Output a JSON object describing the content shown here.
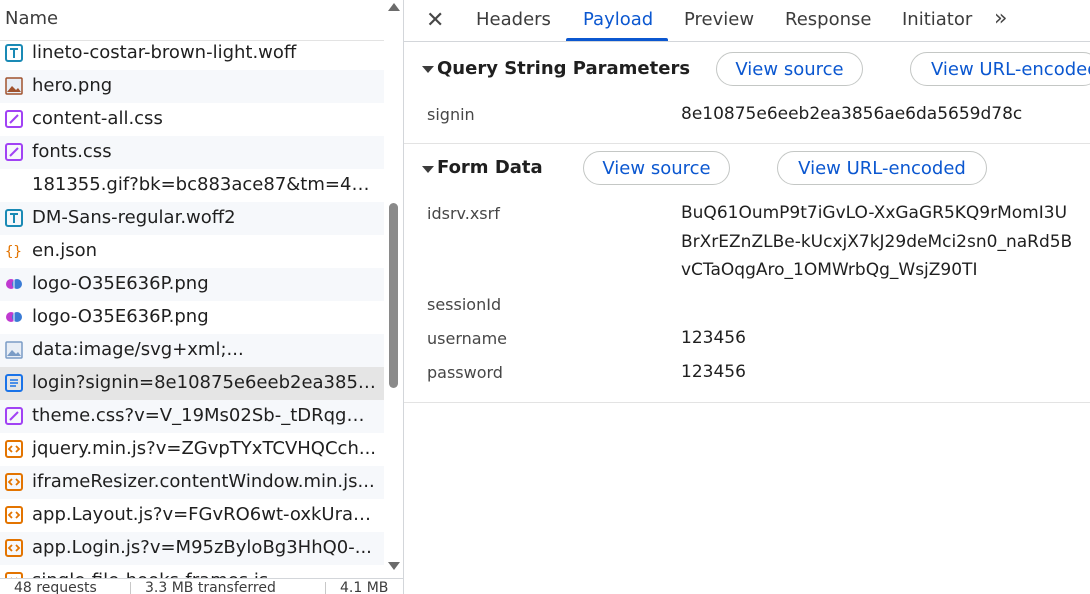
{
  "list": {
    "header": "Name",
    "rows": [
      {
        "name": "lineto-costar-brown-light.woff",
        "icon": "font-icon",
        "color": "#1a8ab5"
      },
      {
        "name": "hero.png",
        "icon": "image-icon",
        "color": "#a0522d"
      },
      {
        "name": "content-all.css",
        "icon": "stylesheet-icon",
        "color": "#a142f4"
      },
      {
        "name": "fonts.css",
        "icon": "stylesheet-icon",
        "color": "#a142f4"
      },
      {
        "name": "181355.gif?bk=bc883ace87&tm=44...",
        "icon": "blank-icon",
        "color": "#ffffff"
      },
      {
        "name": "DM-Sans-regular.woff2",
        "icon": "font-icon",
        "color": "#1a8ab5"
      },
      {
        "name": "en.json",
        "icon": "json-icon",
        "color": "#e37400"
      },
      {
        "name": "logo-O35E636P.png",
        "icon": "brain-logo-icon",
        "color": "#c03ad0"
      },
      {
        "name": "logo-O35E636P.png",
        "icon": "brain-logo-icon",
        "color": "#c03ad0"
      },
      {
        "name": "data:image/svg+xml;...",
        "icon": "image-icon",
        "color": "#7a9cc6"
      },
      {
        "name": "login?signin=8e10875e6eeb2ea3856...",
        "icon": "document-icon",
        "color": "#1a73e8"
      },
      {
        "name": "theme.css?v=V_19Ms02Sb-_tDRqgN...",
        "icon": "stylesheet-icon",
        "color": "#a142f4"
      },
      {
        "name": "jquery.min.js?v=ZGvpTYxTCVHQCch...",
        "icon": "script-icon",
        "color": "#e37400"
      },
      {
        "name": "iframeResizer.contentWindow.min.js...",
        "icon": "script-icon",
        "color": "#e37400"
      },
      {
        "name": "app.Layout.js?v=FGvRO6wt-oxkUrab...",
        "icon": "script-icon",
        "color": "#e37400"
      },
      {
        "name": "app.Login.js?v=M95zByloBg3HhQ0-...",
        "icon": "script-icon",
        "color": "#e37400"
      },
      {
        "name": "single-file-hooks-frames.js",
        "icon": "script-icon",
        "color": "#e37400"
      }
    ],
    "selected_index": 10
  },
  "status": {
    "requests": "48 requests",
    "transferred": "3.3 MB transferred",
    "resources": "4.1 MB"
  },
  "tabs": {
    "close": "✕",
    "items": [
      "Headers",
      "Payload",
      "Preview",
      "Response",
      "Initiator"
    ],
    "active": "Payload",
    "more": "»"
  },
  "query": {
    "title": "Query String Parameters",
    "view_source": "View source",
    "view_url_encoded": "View URL-encoded",
    "key": "signin",
    "value": "8e10875e6eeb2ea3856ae6da5659d78c"
  },
  "form": {
    "title": "Form Data",
    "view_source": "View source",
    "view_url_encoded": "View URL-encoded",
    "fields": [
      {
        "key": "idsrv.xsrf",
        "lines": [
          "BuQ61OumP9t7iGvLO-XxGaGR5KQ9rMomI3U",
          "BrXrEZnZLBe-kUcxjX7kJ29deMci2sn0_naRd5B",
          "vCTaOqgAro_1OMWrbQg_WsjZ90TI"
        ]
      },
      {
        "key": "sessionId",
        "lines": [
          ""
        ]
      },
      {
        "key": "username",
        "lines": [
          "123456"
        ]
      },
      {
        "key": "password",
        "lines": [
          "123456"
        ]
      }
    ]
  },
  "colors": {
    "accent": "#0b57d0",
    "selected_row": "#e5e5e5"
  }
}
